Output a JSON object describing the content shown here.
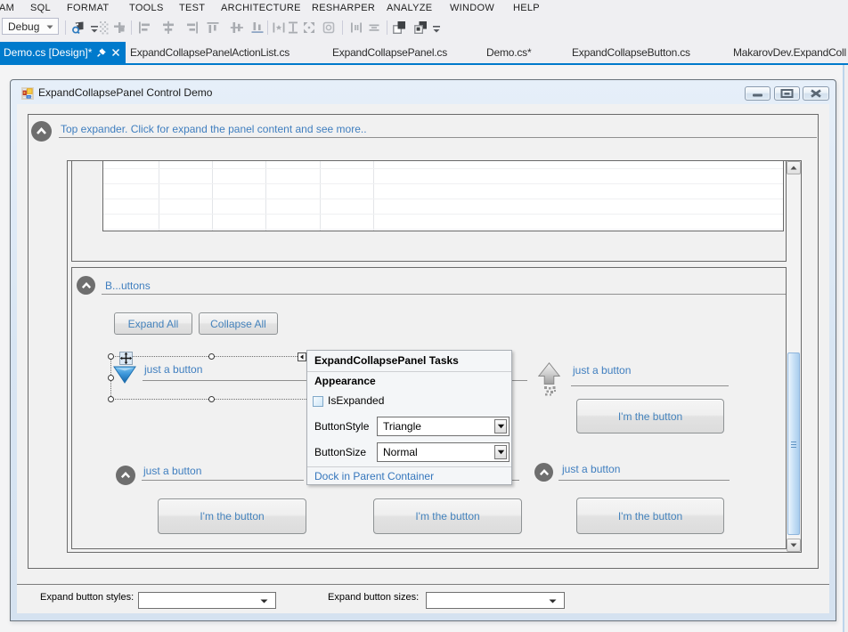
{
  "menu": {
    "items": [
      "AM",
      "SQL",
      "FORMAT",
      "TOOLS",
      "TEST",
      "ARCHITECTURE",
      "RESHARPER",
      "ANALYZE",
      "WINDOW",
      "HELP"
    ]
  },
  "toolbar": {
    "debug": "Debug",
    "icons": [
      "preview-selected-items",
      "toolbar-overflow",
      "snap-to-grid-dots",
      "align-to-grid",
      "align-lefts",
      "align-centers",
      "align-rights",
      "align-tops",
      "align-middles",
      "align-bottoms",
      "make-same-width",
      "make-same-height",
      "make-same-size",
      "size-to-grid",
      "horizontal-spacing",
      "vertical-spacing",
      "bring-to-front",
      "send-to-back",
      "layout-overflow"
    ]
  },
  "tabs": {
    "active": "Demo.cs [Design]*",
    "others": [
      "ExpandCollapsePanelActionList.cs",
      "ExpandCollapsePanel.cs",
      "Demo.cs*",
      "ExpandCollapseButton.cs",
      "MakarovDev.ExpandColl"
    ]
  },
  "form": {
    "title": "ExpandCollapsePanel Control Demo",
    "top_expander_label": "Top expander. Click for expand the panel content and see more..",
    "buttons_panel_label": "B...uttons",
    "expand_all": "Expand All",
    "collapse_all": "Collapse All",
    "just_a_button": "just a button",
    "im_the_button": "I'm the button",
    "styles_label": "Expand button styles:",
    "sizes_label": "Expand button sizes:"
  },
  "smart_tag": {
    "title": "ExpandCollapsePanel Tasks",
    "section": "Appearance",
    "is_expanded": "IsExpanded",
    "button_style_label": "ButtonStyle",
    "button_style_value": "Triangle",
    "button_size_label": "ButtonSize",
    "button_size_value": "Normal",
    "dock_link": "Dock in Parent Container"
  },
  "colors": {
    "accent": "#007ACC",
    "expander_text": "#3F7EBF",
    "titlebar": "#D9E6F3",
    "selection_gray": "#6E6E6E"
  }
}
